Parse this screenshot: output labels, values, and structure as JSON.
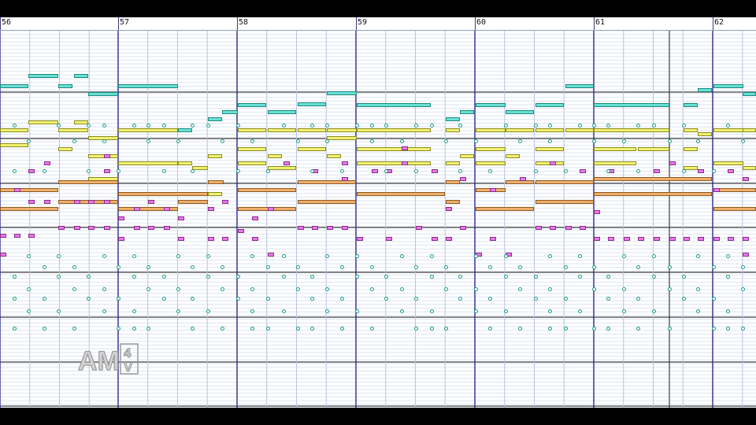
{
  "window": {
    "app": "piano roll sequencer"
  },
  "ruler": {
    "measures": [
      "56",
      "57",
      "58",
      "59",
      "60",
      "61",
      "62"
    ]
  },
  "watermark": {
    "text": "AM4V"
  },
  "colors": {
    "background": "#ffffff",
    "row_line": "#dce4f2",
    "octave_line": "#3c3c3c",
    "measure_line": "#2a2a8c",
    "beat_line": "#b8c4de",
    "track_cyan": "#6ae0d4",
    "track_yellow": "#f2f272",
    "track_orange": "#f0ae6c",
    "track_magenta": "#e87ae8",
    "drum": "#1a9c86"
  },
  "tracks": [
    {
      "name": "cyan",
      "icon": "cyan-note"
    },
    {
      "name": "yellow",
      "icon": "yellow-note"
    },
    {
      "name": "orange",
      "icon": "orange-note"
    },
    {
      "name": "magenta",
      "icon": "magenta-note"
    },
    {
      "name": "drums",
      "icon": "drum-hit"
    }
  ]
}
